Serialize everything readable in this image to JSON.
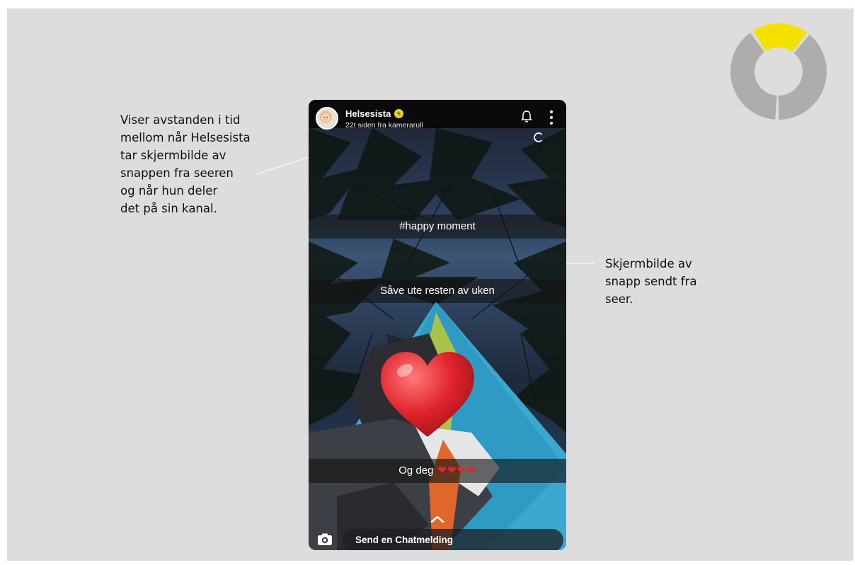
{
  "annotations": {
    "left": "Viser avstanden i tid\nmellom når Helsesista\ntar skjermbilde av\nsnappen fra seeren\nog når hun deler\ndet på sin kanal.",
    "right": "Skjermbilde av\nsnapp sendt fra\nseer."
  },
  "snap": {
    "username": "Helsesista",
    "subtitle": "22t siden fra kamerarull",
    "captions": [
      "#happy moment",
      "Såve ute resten av uken",
      "Og deg"
    ],
    "caption_emoji": "❤❤❤❤",
    "chat_placeholder": "Send en Chatmelding"
  },
  "icons": {
    "avatar": "bitmoji-avatar-icon",
    "verified": "star-badge-icon",
    "bell": "bell-icon",
    "menu": "kebab-menu-icon",
    "loading": "loading-spinner-icon",
    "heart": "red-heart-emoji",
    "swipe": "chevron-up-icon",
    "camera": "camera-icon"
  },
  "colors": {
    "background": "#dddddd",
    "accent_yellow": "#f5e100",
    "donut_gray": "#adadad",
    "heart_red": "#e1252e"
  },
  "progress": {
    "fraction_highlighted": 0.2
  }
}
